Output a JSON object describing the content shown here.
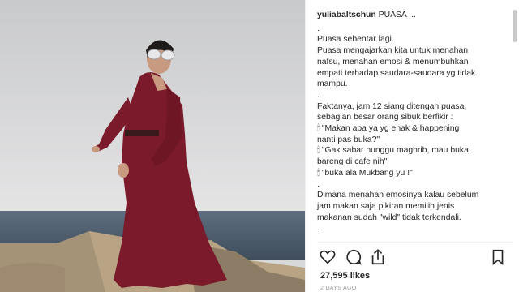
{
  "post": {
    "username": "yuliabaltschun",
    "caption_title": "PUASA ...",
    "caption_lines": [
      ".",
      "Puasa sebentar lagi.",
      "Puasa mengajarkan kita untuk menahan",
      "nafsu, menahan emosi & menumbuhkan",
      "empati terhadap saudara-saudara yg tidak",
      "mampu.",
      ".",
      "Faktanya, jam 12 siang ditengah puasa,",
      "sebagian besar orang sibuk berfikir :",
      "🕯 \"Makan apa ya yg enak & happening",
      "nanti pas buka?\"",
      "🕯 \"Gak sabar nunggu maghrib, mau buka",
      "bareng di cafe nih\"",
      "🕯 \"buka ala Mukbang yu !\"",
      ".",
      "Dimana menahan emosinya kalau sebelum",
      "jam makan saja pikiran memilih jenis",
      "makanan sudah \"wild\" tidak terkendali.",
      "."
    ],
    "likes": "27,595 likes",
    "timestamp": "2 DAYS AGO"
  },
  "icons": {
    "like": "heart-icon",
    "comment": "comment-icon",
    "share": "share-icon",
    "save": "bookmark-icon"
  },
  "colors": {
    "text": "#262626",
    "muted": "#999999",
    "dress": "#7a1a2a"
  }
}
